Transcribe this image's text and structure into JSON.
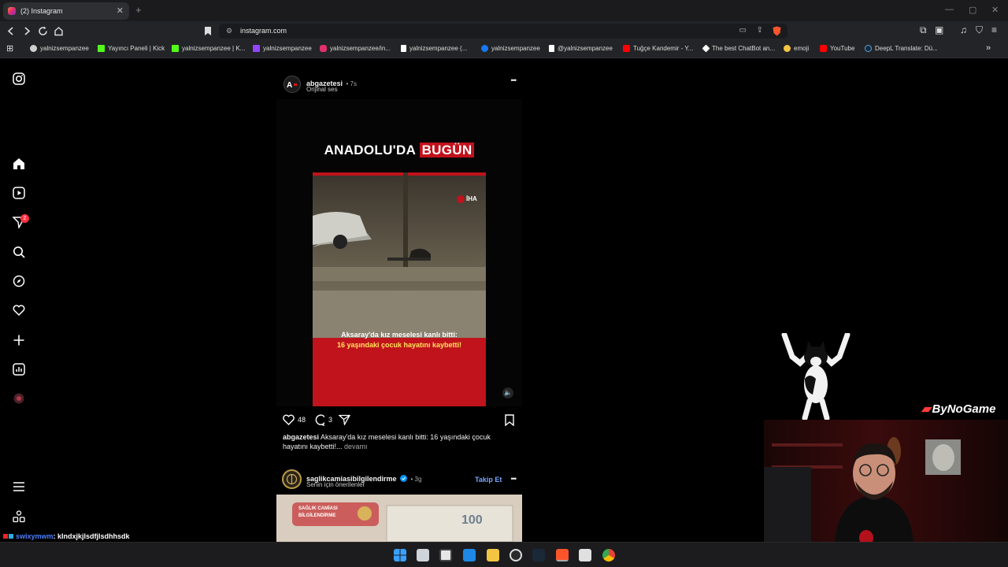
{
  "browser": {
    "tab_title": "(2) Instagram",
    "tab_close": "✕",
    "new_tab": "+",
    "url": "instagram.com"
  },
  "bookmarks": [
    {
      "label": "yalnizsempanzee",
      "color": "#cfcfcf"
    },
    {
      "label": "Yayıncı Paneli | Kick",
      "color": "#53fc18"
    },
    {
      "label": "yalnizsempanzee | K...",
      "color": "#53fc18"
    },
    {
      "label": "yalnizsempanzee",
      "color": "#9146ff"
    },
    {
      "label": "yalnizsempanzee/in...",
      "color": "#e1306c"
    },
    {
      "label": "yalnizsempanzee (...",
      "color": "#ffffff"
    },
    {
      "label": "yalnizsempanzee",
      "color": "#1877f2"
    },
    {
      "label": "@yalnizsempanzee",
      "color": "#ffffff"
    },
    {
      "label": "Tuğçe Kandemir - Y...",
      "color": "#ff0000"
    },
    {
      "label": "The best ChatBot an...",
      "color": "#ffffff"
    },
    {
      "label": "emoji",
      "color": "#f5c542"
    },
    {
      "label": "YouTube",
      "color": "#ff0000"
    },
    {
      "label": "DeepL Translate: Dü...",
      "color": "#0f2b46"
    }
  ],
  "sidebar": {
    "notification_count": "2"
  },
  "post1": {
    "username": "abgazetesi",
    "time": "• 7s",
    "audio": "Orijinal ses",
    "headline_white": "ANADOLU'DA",
    "headline_red": "BUGÜN",
    "watermark": "İHA",
    "video_caption_line1": "Aksaray'da kız meselesi kanlı bitti:",
    "video_caption_line2": "16 yaşındaki çocuk hayatını kaybetti!",
    "likes": "48",
    "comments": "3",
    "caption_user": "abgazetesi",
    "caption_text": " Aksaray'da kız meselesi kanlı bitti: 16 yaşındaki çocuk hayatını kaybetti!...",
    "more": " devamı",
    "more_menu": "•••"
  },
  "post2": {
    "username": "saglikcamiasibilgilendirme",
    "time": "• 3g",
    "subtitle": "Senin için önerilenler",
    "follow": "Takip Et",
    "more_menu": "•••",
    "image_text": "SAĞLIK CAMİASI BİLGİLENDİRME",
    "banknote": "100"
  },
  "overlay": {
    "brand": "ByNoGame",
    "chat_user": "swixymwm",
    "chat_message": ": kIndxjkjlsdfjlsdhhsdk"
  }
}
